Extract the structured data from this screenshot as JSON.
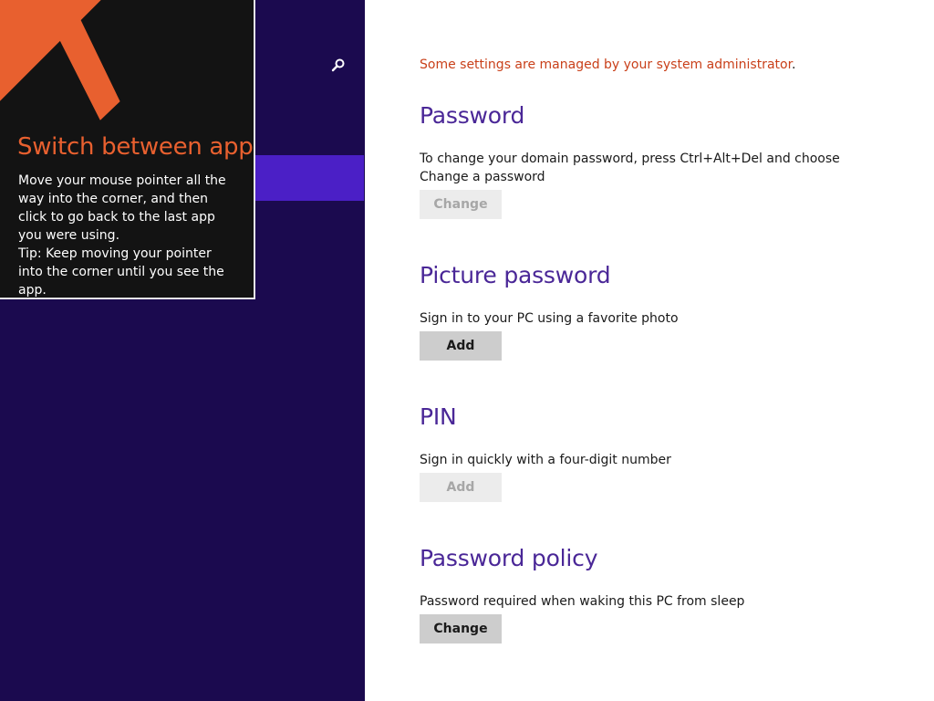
{
  "tip": {
    "title": "Switch between apps",
    "body": "Move your mouse pointer all the way into the corner, and then click to go back to the last app you were using.",
    "tip": "Tip: Keep moving your pointer into the corner until you see the app.",
    "arrow_color": "#e8602f"
  },
  "nav": {
    "search_icon": "search-icon",
    "background": "#1b0a4f",
    "selected_color": "#4b1fc6"
  },
  "main": {
    "admin_notice": "Some settings are managed by your system administrator",
    "admin_notice_punct": ".",
    "sections": [
      {
        "title": "Password",
        "description": "To change your domain password, press Ctrl+Alt+Del and choose Change a password",
        "button": {
          "label": "Change",
          "enabled": false
        }
      },
      {
        "title": "Picture password",
        "description": "Sign in to your PC using a favorite photo",
        "button": {
          "label": "Add",
          "enabled": true
        }
      },
      {
        "title": "PIN",
        "description": "Sign in quickly with a four-digit number",
        "button": {
          "label": "Add",
          "enabled": false
        }
      },
      {
        "title": "Password policy",
        "description": "Password required when waking this PC from sleep",
        "button": {
          "label": "Change",
          "enabled": true
        }
      }
    ]
  },
  "colors": {
    "accent_title": "#4a2797",
    "notice": "#c9401a"
  }
}
